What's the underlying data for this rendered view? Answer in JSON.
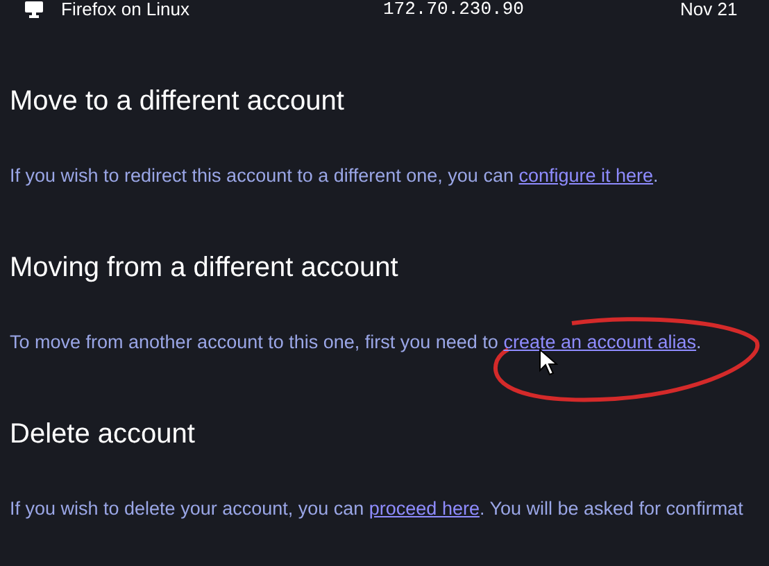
{
  "session_row": {
    "device": "Firefox on Linux",
    "ip": "172.70.230.90",
    "date": "Nov 21"
  },
  "sections": [
    {
      "title": "Move to a different account",
      "text_before": "If you wish to redirect this account to a different one, you can ",
      "link": "configure it here",
      "text_after": "."
    },
    {
      "title": "Moving from a different account",
      "text_before": "To move from another account to this one, first you need to ",
      "link": "create an account alias",
      "text_after": "."
    },
    {
      "title": "Delete account",
      "text_before": "If you wish to delete your account, you can ",
      "link": "proceed here",
      "text_after": ". You will be asked for confirmat"
    }
  ]
}
